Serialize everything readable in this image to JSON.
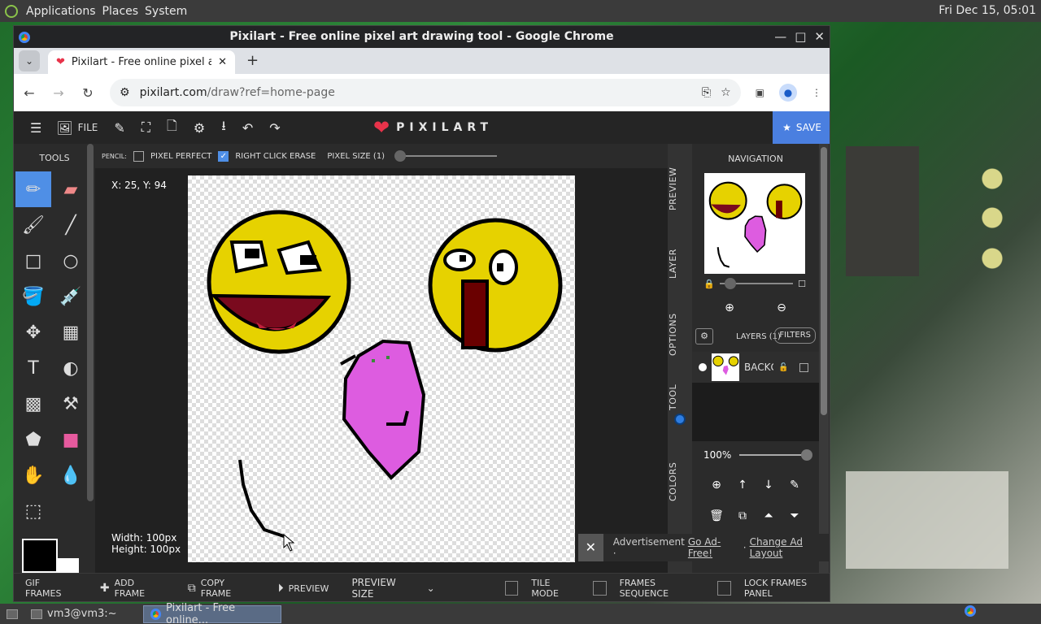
{
  "desktop": {
    "top_panel": {
      "menus": [
        "Applications",
        "Places",
        "System"
      ],
      "clock": "Fri Dec 15, 05:01"
    },
    "taskbar": {
      "terminal": "vm3@vm3:~",
      "chrome": "Pixilart - Free online..."
    }
  },
  "window": {
    "title": "Pixilart - Free online pixel art drawing tool - Google Chrome",
    "tab_title": "Pixilart - Free online pixel art",
    "url_host": "pixilart.com",
    "url_path": "/draw?ref=home-page"
  },
  "app": {
    "header": {
      "file_label": "FILE",
      "brand": "PIXILART",
      "save_label": "SAVE"
    },
    "tools_title": "TOOLS",
    "options": {
      "tool_name": "PENCIL:",
      "pixel_perfect": "PIXEL PERFECT",
      "right_click_erase": "RIGHT CLICK ERASE",
      "pixel_size": "PIXEL SIZE (1)"
    },
    "canvas_info": {
      "coords": "X: 25, Y: 94",
      "width": "Width: 100px",
      "height": "Height: 100px"
    },
    "side_tabs": {
      "preview": "PREVIEW",
      "layer": "LAYER",
      "options": "OPTIONS",
      "tool": "TOOL",
      "colors": "COLORS"
    },
    "navigation": {
      "title": "NAVIGATION"
    },
    "layers": {
      "title": "LAYERS (1)",
      "filters": "FILTERS",
      "layer_name": "BACKGROUND",
      "opacity": "100%"
    },
    "ad": {
      "label": "Advertisement ·",
      "go_ad_free": "Go Ad-Free!",
      "separator": "·",
      "change_layout": "Change Ad Layout"
    },
    "bottom": {
      "gif_frames": "GIF FRAMES",
      "add_frame": "ADD FRAME",
      "copy_frame": "COPY FRAME",
      "preview": "PREVIEW",
      "preview_size": "PREVIEW SIZE",
      "tile_mode": "TILE MODE",
      "frames_sequence": "FRAMES SEQUENCE",
      "lock_frames": "LOCK FRAMES PANEL"
    }
  },
  "colors": {
    "primary": "#000000",
    "secondary": "#ffffff",
    "accent": "#4f8fe6",
    "brand_red": "#e8334a"
  }
}
